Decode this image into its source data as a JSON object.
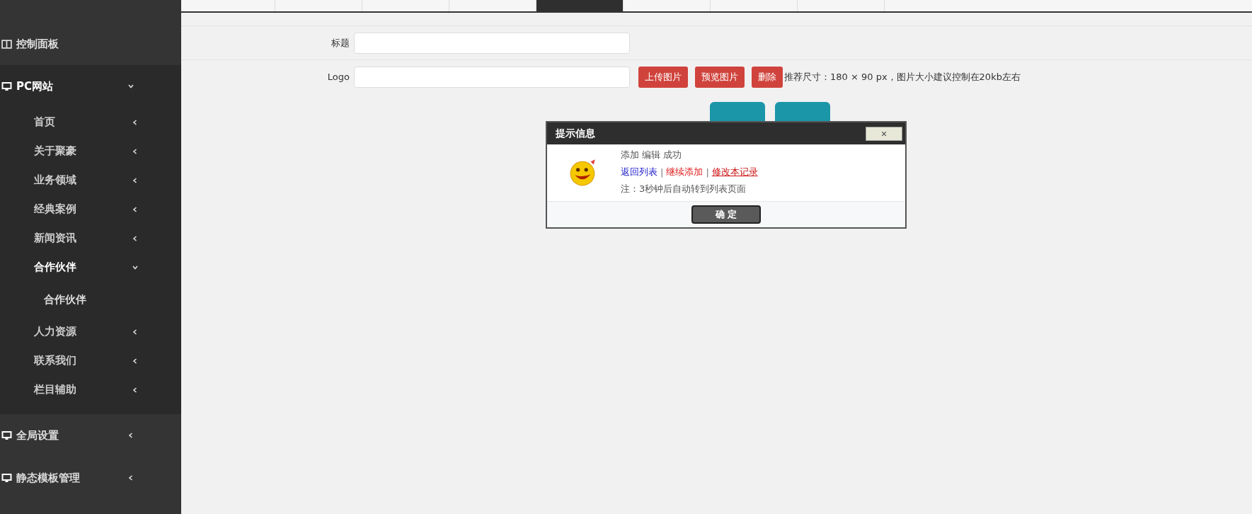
{
  "top_tabs": [
    {
      "selected": false
    },
    {
      "selected": false
    },
    {
      "selected": false
    },
    {
      "selected": false
    },
    {
      "selected": true
    },
    {
      "selected": false
    },
    {
      "selected": false
    },
    {
      "selected": false
    }
  ],
  "sidebar": {
    "items": [
      {
        "label": "控制面板",
        "kind": "dashboard",
        "expanded": false
      },
      {
        "label": "PC网站",
        "kind": "menu",
        "expanded": true,
        "children": [
          {
            "label": "首页",
            "expanded": false
          },
          {
            "label": "关于聚豪",
            "expanded": false
          },
          {
            "label": "业务领域",
            "expanded": false
          },
          {
            "label": "经典案例",
            "expanded": false
          },
          {
            "label": "新闻资讯",
            "expanded": false
          },
          {
            "label": "合作伙伴",
            "expanded": true,
            "children": [
              {
                "label": "合作伙伴"
              }
            ]
          },
          {
            "label": "人力资源",
            "expanded": false
          },
          {
            "label": "联系我们",
            "expanded": false
          },
          {
            "label": "栏目辅助",
            "expanded": false
          }
        ]
      },
      {
        "label": "全局设置",
        "kind": "menu",
        "expanded": false
      },
      {
        "label": "静态模板管理",
        "kind": "menu",
        "expanded": false
      }
    ]
  },
  "form": {
    "fields": [
      {
        "label": "标题",
        "kind": "text"
      },
      {
        "label": "Logo",
        "kind": "upload",
        "buttons": [
          "上传图片",
          "预览图片",
          "删除"
        ],
        "hint": "推荐尺寸：180 × 90 px，图片大小建议控制在20kb左右"
      }
    ]
  },
  "dialog": {
    "title": "提示信息",
    "close": "×",
    "message": "添加 编辑 成功",
    "links": [
      {
        "label": "返回列表",
        "underline": false
      },
      {
        "label": "继续添加",
        "underline": false
      },
      {
        "label": "修改本记录",
        "underline": true
      }
    ],
    "separator": "|",
    "note": "注：3秒钟后自动转到列表页面",
    "ok": "确 定"
  }
}
